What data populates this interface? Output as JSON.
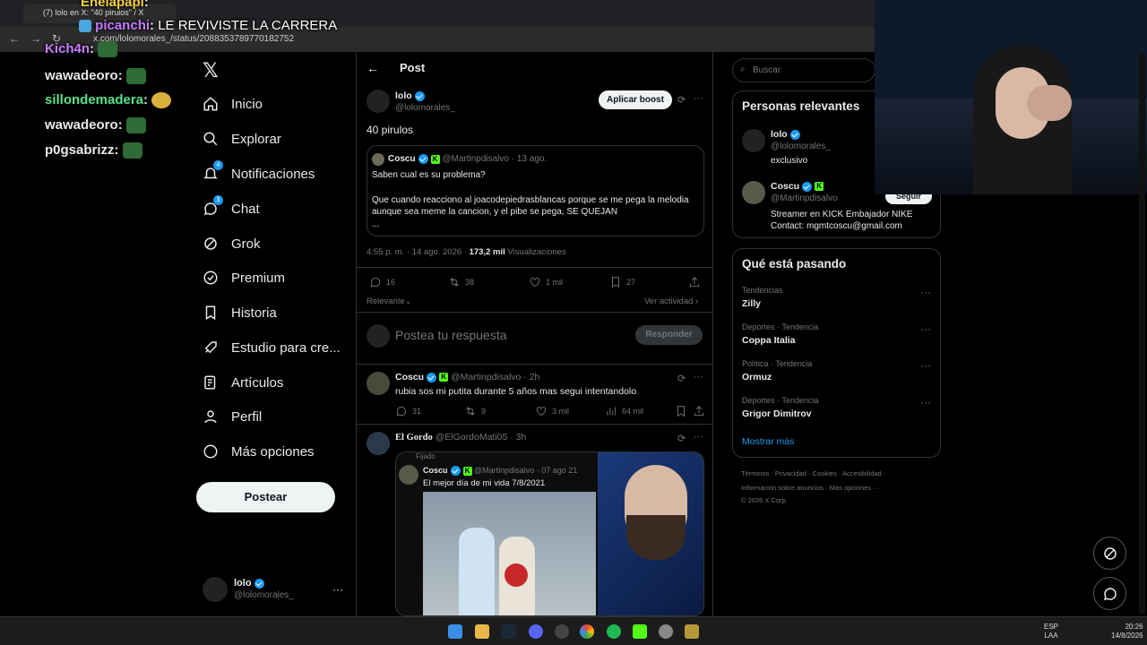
{
  "browser": {
    "tab_title": "(7) lolo en X: \"40 pirulos\" / X",
    "url": "x.com/lolomorales_/status/2088353789770182752"
  },
  "chat": [
    {
      "user": "Enelapapi",
      "color": "#f4d03f",
      "msg": ""
    },
    {
      "user": "picanchi",
      "color": "#c77dff",
      "msg": "LE REVIVISTE LA CARRERA"
    },
    {
      "user": "Kich4n",
      "color": "#c77dff",
      "msg": ""
    },
    {
      "user": "wawadeoro",
      "color": "#ffffff",
      "msg": ""
    },
    {
      "user": "sillondemadera",
      "color": "#57e389",
      "msg": ""
    },
    {
      "user": "wawadeoro",
      "color": "#ffffff",
      "msg": ""
    },
    {
      "user": "p0gsabrizz",
      "color": "#ffffff",
      "msg": ""
    }
  ],
  "nav": {
    "items": [
      "Inicio",
      "Explorar",
      "Notificaciones",
      "Chat",
      "Grok",
      "Premium",
      "Historia",
      "Estudio para cre...",
      "Artículos",
      "Perfil",
      "Más opciones"
    ],
    "notif_badge": "4",
    "chat_badge": "3",
    "post_button": "Postear",
    "account": {
      "name": "lolo",
      "handle": "@lolomorales_"
    }
  },
  "header": {
    "back": "←",
    "title": "Post"
  },
  "post": {
    "name": "lolo",
    "handle": "@lolomorales_",
    "boost": "Aplicar boost",
    "text": "40 pirulos",
    "quote": {
      "name": "Coscu",
      "handle": "@Martinpdisalvo",
      "time": "· 13 ago.",
      "line1": "Saben cual es su problema?",
      "line2": "Que cuando reacciono al joacodepiedrasblancas porque se me pega la melodia aunque sea meme la cancion, y el pibe se pega, SE QUEJAN",
      "line3": "..."
    },
    "timestamp": "4:55 p. m. · 14 ago. 2026 ·",
    "views": "173,2 mil",
    "views_label": "Visualizaciones",
    "metrics": {
      "replies": "16",
      "reposts": "38",
      "likes": "1 mil",
      "bookmarks": "27"
    },
    "sort": "Relevante",
    "activity": "Ver actividad"
  },
  "reply_box": {
    "placeholder": "Postea tu respuesta",
    "button": "Responder"
  },
  "reply1": {
    "name": "Coscu",
    "handle": "@Martinpdisalvo",
    "time": "· 2h",
    "text": "rubia sos mi putita durante 5 años mas segui intentandolo",
    "replies": "31",
    "reposts": "9",
    "likes": "3 mil",
    "views": "64 mil"
  },
  "reply2": {
    "name": "El Gordo",
    "handle": "@ElGordoMati05",
    "time": "· 3h",
    "pinned": "Fijado",
    "inner_name": "Coscu",
    "inner_handle": "@Martinpdisalvo",
    "inner_time": "· 07 ago 21",
    "inner_text": "El mejor día de mi vida 7/8/2021"
  },
  "search": {
    "placeholder": "Buscar"
  },
  "relevant": {
    "title": "Personas relevantes",
    "people": [
      {
        "name": "lolo",
        "handle": "@lolomorales_",
        "bio": "exclusivo"
      },
      {
        "name": "Coscu",
        "handle": "@Martinpdisalvo",
        "bio": "Streamer en KICK Embajador NIKE Contact: mgmtcoscu@gmail.com",
        "follow": "Seguir"
      }
    ]
  },
  "trends": {
    "title": "Qué está pasando",
    "items": [
      {
        "cat": "Tendencias",
        "name": "Zilly"
      },
      {
        "cat": "Deportes · Tendencia",
        "name": "Coppa Italia"
      },
      {
        "cat": "Política · Tendencia",
        "name": "Ormuz"
      },
      {
        "cat": "Deportes · Tendencia",
        "name": "Grigor Dimitrov"
      }
    ],
    "more": "Mostrar más"
  },
  "footer": {
    "line1": "Términos · Privacidad · Cookies · Accesibilidad ·",
    "line2": "Información sobre anuncios · Más opciones ···",
    "line3": "© 2026 X Corp."
  },
  "taskbar": {
    "lang": "ESP",
    "layout": "LAA",
    "time": "20:26",
    "date": "14/8/2026"
  }
}
